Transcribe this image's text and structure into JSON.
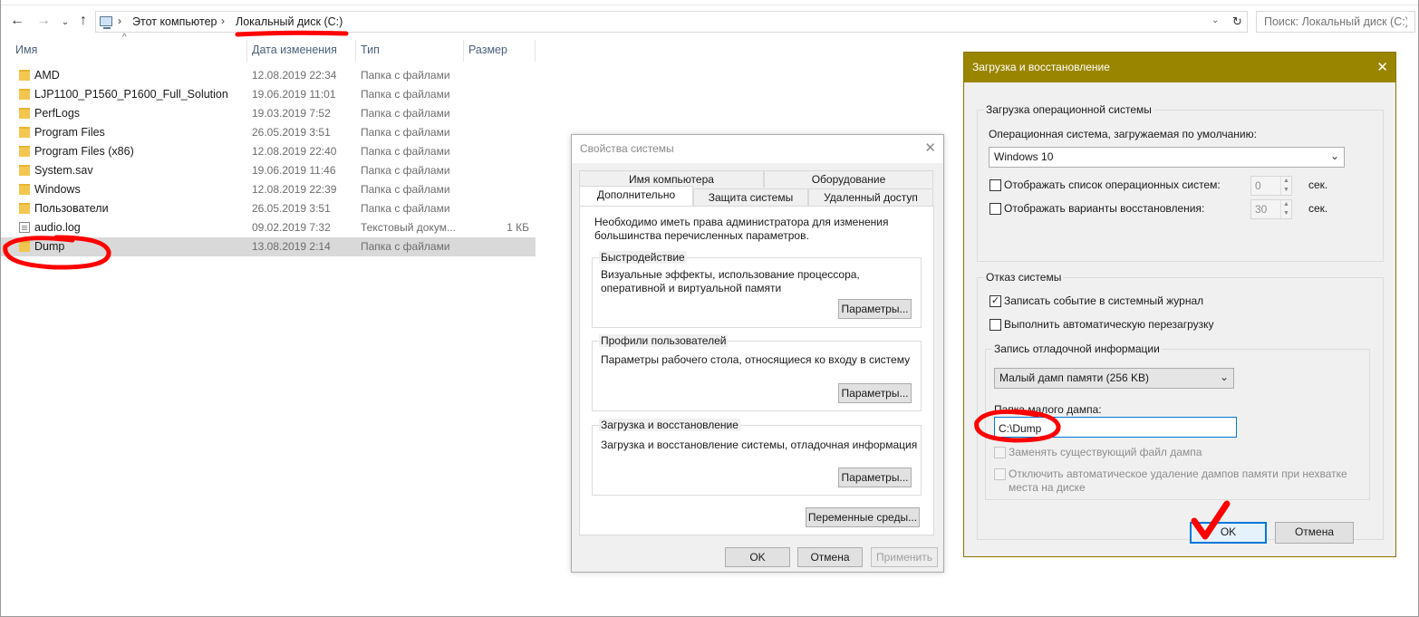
{
  "explorer": {
    "breadcrumb": [
      "Этот компьютер",
      "Локальный диск (C:)"
    ],
    "search_placeholder": "Поиск: Локальный диск (C:)",
    "columns": {
      "name": "Имя",
      "date": "Дата изменения",
      "type": "Тип",
      "size": "Размер"
    },
    "files": [
      {
        "name": "AMD",
        "date": "12.08.2019 22:34",
        "type": "Папка с файлами",
        "size": "",
        "icon": "folder-icon"
      },
      {
        "name": "LJP1100_P1560_P1600_Full_Solution",
        "date": "19.06.2019 11:01",
        "type": "Папка с файлами",
        "size": "",
        "icon": "folder-icon"
      },
      {
        "name": "PerfLogs",
        "date": "19.03.2019 7:52",
        "type": "Папка с файлами",
        "size": "",
        "icon": "folder-icon"
      },
      {
        "name": "Program Files",
        "date": "26.05.2019 3:51",
        "type": "Папка с файлами",
        "size": "",
        "icon": "folder-icon"
      },
      {
        "name": "Program Files (x86)",
        "date": "12.08.2019 22:40",
        "type": "Папка с файлами",
        "size": "",
        "icon": "folder-icon"
      },
      {
        "name": "System.sav",
        "date": "19.06.2019 11:46",
        "type": "Папка с файлами",
        "size": "",
        "icon": "folder-icon"
      },
      {
        "name": "Windows",
        "date": "12.08.2019 22:39",
        "type": "Папка с файлами",
        "size": "",
        "icon": "folder-icon"
      },
      {
        "name": "Пользователи",
        "date": "26.05.2019 3:51",
        "type": "Папка с файлами",
        "size": "",
        "icon": "folder-icon"
      },
      {
        "name": "audio.log",
        "date": "09.02.2019 7:32",
        "type": "Текстовый докум...",
        "size": "1 КБ",
        "icon": "text-file-icon"
      },
      {
        "name": "Dump",
        "date": "13.08.2019 2:14",
        "type": "Папка с файлами",
        "size": "",
        "icon": "folder-icon",
        "selected": true
      }
    ]
  },
  "sysprops": {
    "title": "Свойства системы",
    "tabs_row1": [
      "Имя компьютера",
      "Оборудование"
    ],
    "tabs_row2": [
      "Дополнительно",
      "Защита системы",
      "Удаленный доступ"
    ],
    "admin_note": "Необходимо иметь права администратора для изменения большинства перечисленных параметров.",
    "groups": [
      {
        "title": "Быстродействие",
        "text": "Визуальные эффекты, использование процессора, оперативной и виртуальной памяти",
        "button": "Параметры..."
      },
      {
        "title": "Профили пользователей",
        "text": "Параметры рабочего стола, относящиеся ко входу в систему",
        "button": "Параметры..."
      },
      {
        "title": "Загрузка и восстановление",
        "text": "Загрузка и восстановление системы, отладочная информация",
        "button": "Параметры..."
      }
    ],
    "env_button": "Переменные среды...",
    "ok": "OK",
    "cancel": "Отмена",
    "apply": "Применить"
  },
  "bootrec": {
    "title": "Загрузка и восстановление",
    "os_group": "Загрузка операционной системы",
    "default_os_label": "Операционная система, загружаемая по умолчанию:",
    "default_os_value": "Windows 10",
    "show_os_list_label": "Отображать список операционных систем:",
    "show_os_list_checked": false,
    "show_os_list_value": "0",
    "show_recovery_label": "Отображать варианты восстановления:",
    "show_recovery_checked": false,
    "show_recovery_value": "30",
    "sec": "сек.",
    "failure_group": "Отказ системы",
    "write_event_label": "Записать событие в системный журнал",
    "write_event_checked": true,
    "auto_restart_label": "Выполнить автоматическую перезагрузку",
    "auto_restart_checked": false,
    "debug_group": "Запись отладочной информации",
    "dump_type": "Малый дамп памяти (256 KB)",
    "dump_path_label": "Папка малого дампа:",
    "dump_path_value": "C:\\Dump",
    "overwrite_label": "Заменять существующий файл дампа",
    "disable_autodelete_label": "Отключить автоматическое удаление дампов памяти при нехватке места на диске",
    "ok": "OK",
    "cancel": "Отмена"
  },
  "colors": {
    "bootrec_titlebar": "#9a8500",
    "annotation_red": "#ff0000",
    "selection": "#d9d9d9",
    "folder": "#f3c74f"
  }
}
